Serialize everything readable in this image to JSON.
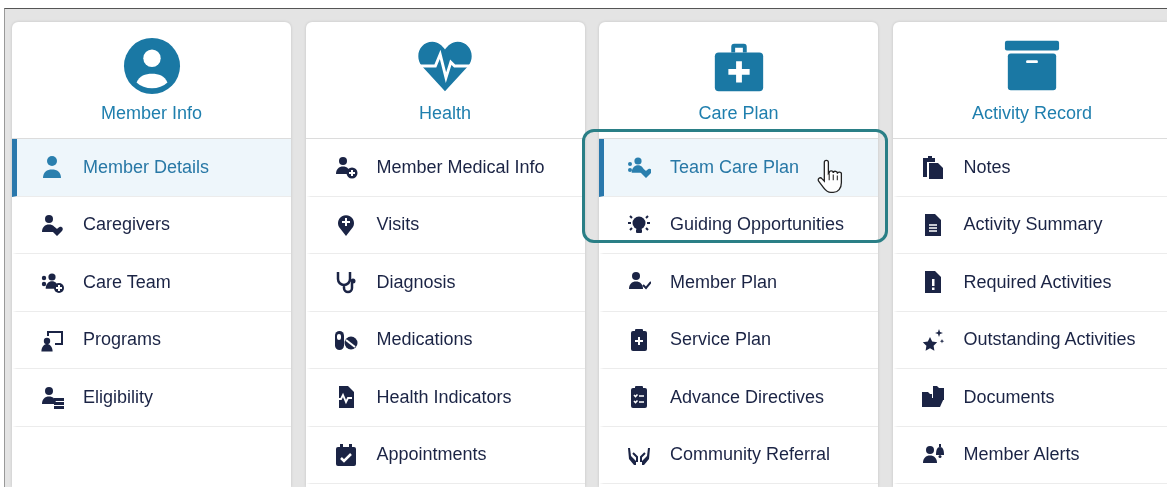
{
  "groups": [
    {
      "title": "Member Info",
      "items": [
        {
          "label": "Member Details",
          "selected": true
        },
        {
          "label": "Caregivers",
          "selected": false
        },
        {
          "label": "Care Team",
          "selected": false
        },
        {
          "label": "Programs",
          "selected": false
        },
        {
          "label": "Eligibility",
          "selected": false
        }
      ]
    },
    {
      "title": "Health",
      "items": [
        {
          "label": "Member Medical Info",
          "selected": false
        },
        {
          "label": "Visits",
          "selected": false
        },
        {
          "label": "Diagnosis",
          "selected": false
        },
        {
          "label": "Medications",
          "selected": false
        },
        {
          "label": "Health Indicators",
          "selected": false
        },
        {
          "label": "Appointments",
          "selected": false
        }
      ]
    },
    {
      "title": "Care Plan",
      "items": [
        {
          "label": "Team Care Plan",
          "selected": true
        },
        {
          "label": "Guiding Opportunities",
          "selected": false
        },
        {
          "label": "Member Plan",
          "selected": false
        },
        {
          "label": "Service Plan",
          "selected": false
        },
        {
          "label": "Advance Directives",
          "selected": false
        },
        {
          "label": "Community Referral",
          "selected": false
        }
      ]
    },
    {
      "title": "Activity Record",
      "items": [
        {
          "label": "Notes",
          "selected": false
        },
        {
          "label": "Activity Summary",
          "selected": false
        },
        {
          "label": "Required Activities",
          "selected": false
        },
        {
          "label": "Outstanding Activities",
          "selected": false
        },
        {
          "label": "Documents",
          "selected": false
        },
        {
          "label": "Member Alerts",
          "selected": false
        }
      ]
    }
  ]
}
